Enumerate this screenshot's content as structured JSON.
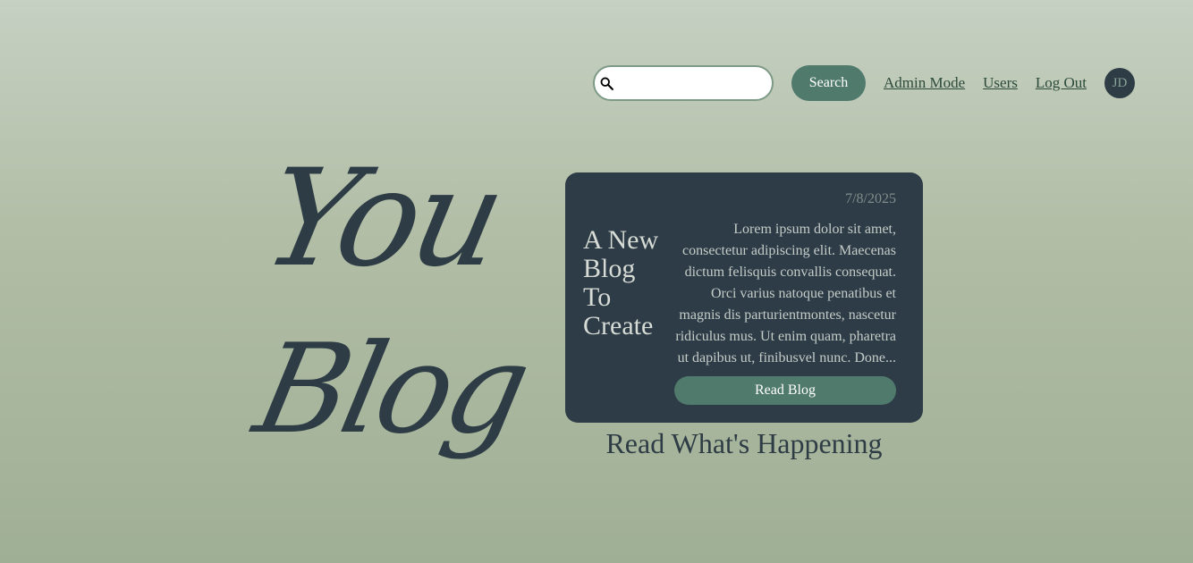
{
  "header": {
    "search": {
      "placeholder": "",
      "value": "",
      "button_label": "Search"
    },
    "links": [
      {
        "label": "Admin Mode"
      },
      {
        "label": "Users"
      },
      {
        "label": "Log Out"
      }
    ],
    "avatar_initials": "JD"
  },
  "hero": {
    "logo_line_1": "You",
    "logo_line_2": "Blog"
  },
  "featured_post": {
    "date": "7/8/2025",
    "title": "A New Blog To Create",
    "excerpt": "Lorem ipsum dolor sit amet, consectetur adipiscing elit. Maecenas dictum felisquis convallis consequat. Orci varius natoque penatibus et magnis dis parturientmontes, nascetur ridiculus mus. Ut enim quam, pharetra ut dapibus ut, finibusvel nunc. Done...",
    "read_button_label": "Read Blog"
  },
  "tagline": "Read What's Happening",
  "icons": {
    "search": "search-icon"
  },
  "colors": {
    "accent": "#4f7a6c",
    "dark": "#2e3c45",
    "card": "#2e3c47"
  }
}
